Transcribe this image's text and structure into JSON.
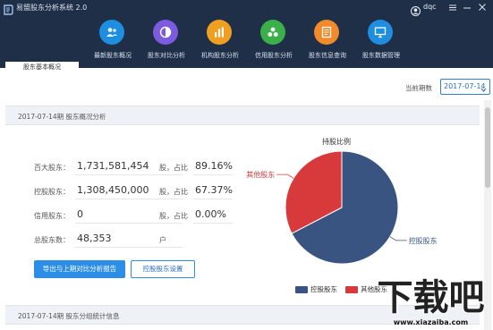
{
  "app": {
    "title": "易盟股东分析系统 2.0",
    "user": "dqc"
  },
  "nav": [
    {
      "label": "最新股东概况",
      "icon": "people-icon",
      "color": "#1e8fe0"
    },
    {
      "label": "股东对比分析",
      "icon": "pie-compare-icon",
      "color": "#7c5be0"
    },
    {
      "label": "机构股东分析",
      "icon": "bar-chart-icon",
      "color": "#f0a020"
    },
    {
      "label": "信用股东分析",
      "icon": "credit-icon",
      "color": "#3bb048"
    },
    {
      "label": "股东信息查询",
      "icon": "document-search-icon",
      "color": "#f08a2a"
    },
    {
      "label": "股东数据管理",
      "icon": "monitor-icon",
      "color": "#1e8fe0"
    }
  ],
  "tabs": {
    "active": "股东基本概况"
  },
  "period": {
    "label": "当前期数",
    "value": "2017-07-14"
  },
  "section1": {
    "title": "2017-07-14期 股东概况分析"
  },
  "stats": [
    {
      "label": "百大股东：",
      "value": "1,731,581,454",
      "unit": "股，占比",
      "pct": "89.16%"
    },
    {
      "label": "控股股东：",
      "value": "1,308,450,000",
      "unit": "股，占比",
      "pct": "67.37%"
    },
    {
      "label": "信用股东：",
      "value": "0",
      "unit": "股，占比",
      "pct": "0.00%"
    },
    {
      "label": "总股东数：",
      "value": "48,353",
      "unit": "户",
      "pct": ""
    }
  ],
  "buttons": {
    "export": "导出与上期对比分析报告",
    "settings": "控股股东设置"
  },
  "chart_data": {
    "type": "pie",
    "title": "持股比例",
    "slices": [
      {
        "name": "控股股东",
        "value": 67.37,
        "color": "#3a5482"
      },
      {
        "name": "其他股东",
        "value": 32.63,
        "color": "#d83a3c"
      }
    ],
    "legend": [
      "控股股东",
      "其他股东"
    ],
    "legend_position": "bottom"
  },
  "section2": {
    "title": "2017-07-14期 股东分组统计信息"
  },
  "watermark": {
    "text": "下载吧",
    "url": "www.xiazaiba.com"
  }
}
